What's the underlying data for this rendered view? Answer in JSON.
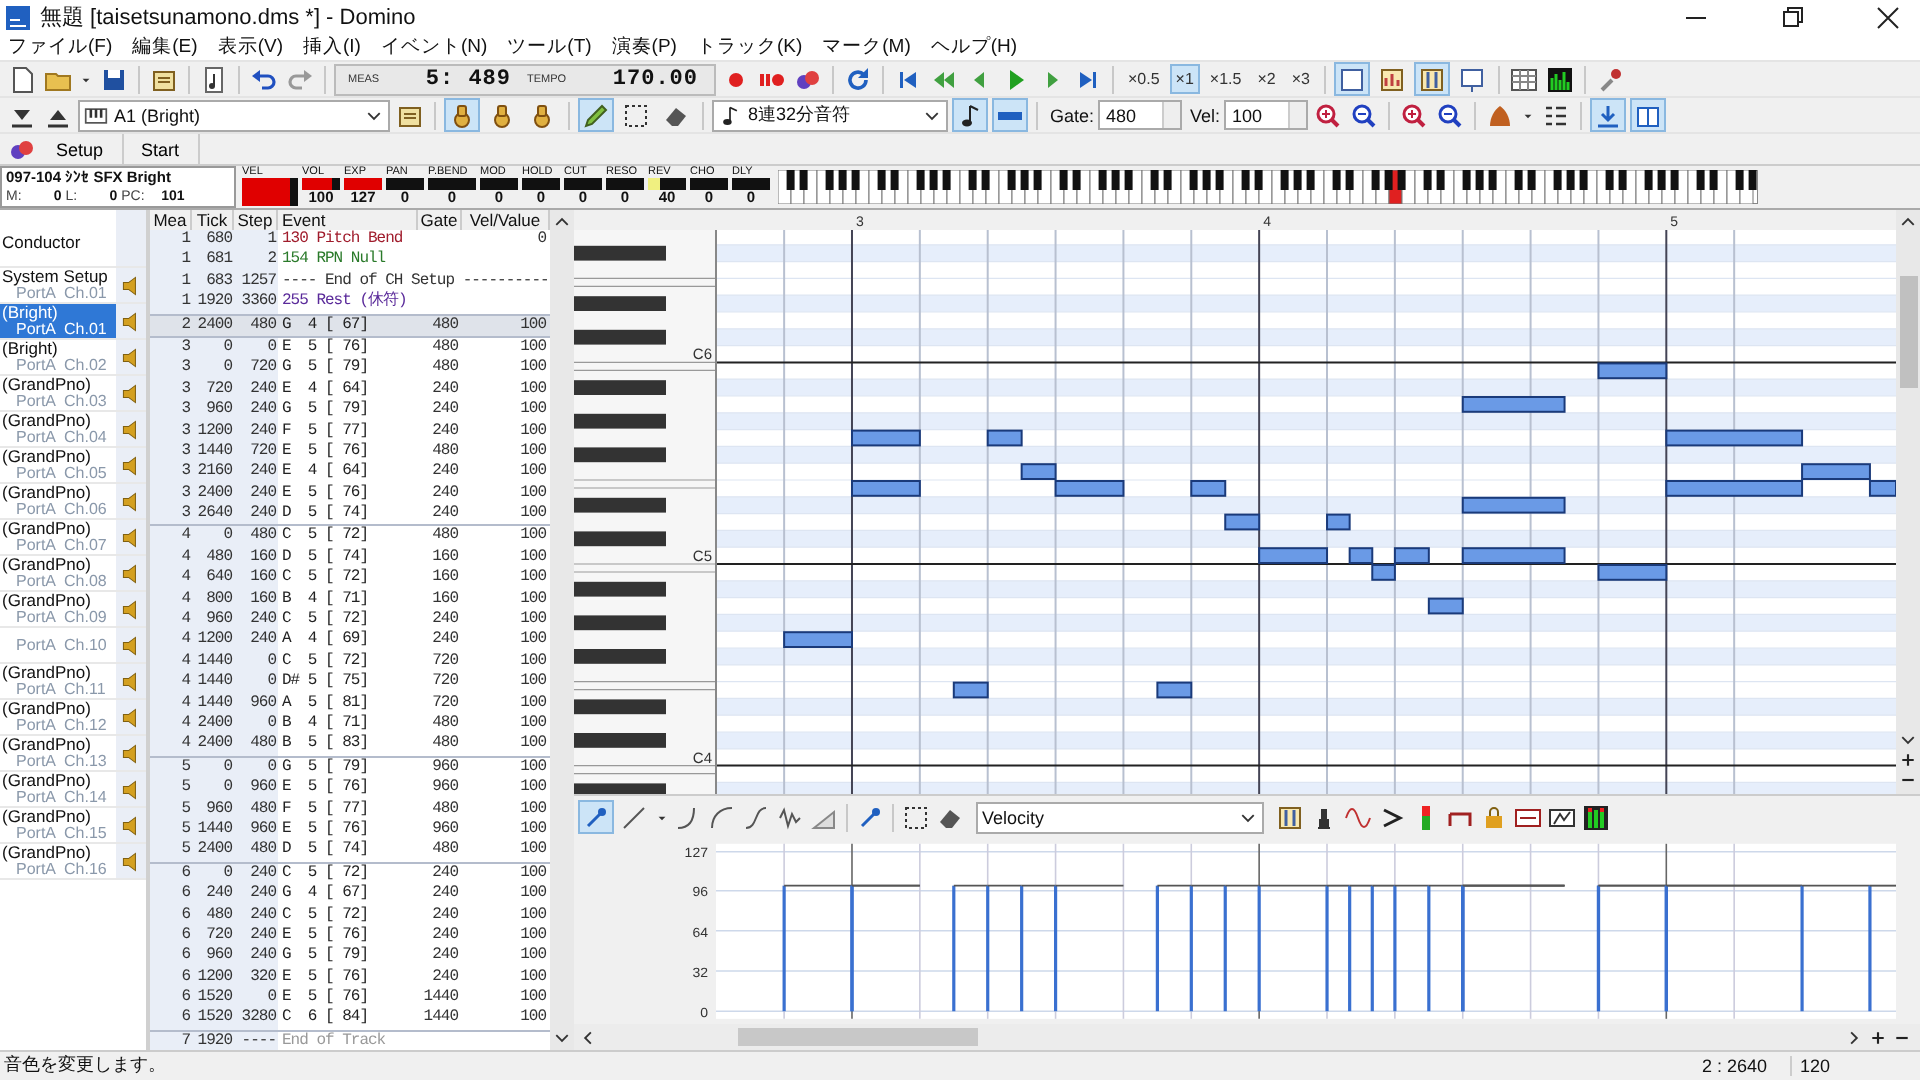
{
  "window": {
    "title": "無題 [taisetsunamono.dms *] - Domino"
  },
  "menu": [
    "ファイル(F)",
    "編集(E)",
    "表示(V)",
    "挿入(I)",
    "イベント(N)",
    "ツール(T)",
    "演奏(P)",
    "トラック(K)",
    "マーク(M)",
    "ヘルプ(H)"
  ],
  "transport": {
    "meas_label": "MEAS",
    "position": "5: 489",
    "tempo_label": "TEMPO",
    "tempo": "170.00"
  },
  "zoom_buttons": [
    {
      "label": "×0.5",
      "selected": false
    },
    {
      "label": "×1",
      "selected": true
    },
    {
      "label": "×1.5",
      "selected": false
    },
    {
      "label": "×2",
      "selected": false
    },
    {
      "label": "×3",
      "selected": false
    }
  ],
  "view_toggles": [
    {
      "selected": true
    },
    {
      "selected": false
    },
    {
      "selected": true
    },
    {
      "selected": false
    }
  ],
  "track_select": {
    "value": "A1 (Bright)"
  },
  "edit_modes": [
    {
      "selected": true
    },
    {
      "selected": false
    },
    {
      "selected": false
    }
  ],
  "draw_tools": [
    {
      "selected": true
    },
    {
      "selected": false
    },
    {
      "selected": false
    }
  ],
  "note_length": {
    "value": "8連32分音符"
  },
  "input_toggles": [
    {
      "selected": true
    },
    {
      "selected": true
    }
  ],
  "gate": {
    "label": "Gate:",
    "value": "480"
  },
  "velocity": {
    "label": "Vel:",
    "value": "100"
  },
  "panel_toggles": [
    {
      "selected": true
    },
    {
      "selected": true
    }
  ],
  "view_buttons": [
    "Setup",
    "Start"
  ],
  "channel_strip": {
    "instrument": "097-104 ｼﾝｾ SFX Bright",
    "m_label": "M:",
    "m": "0",
    "l_label": "L:",
    "l": "0",
    "pc_label": "PC:",
    "pc": "101",
    "meters": [
      {
        "label": "VEL",
        "level": 0.85,
        "color": "#e00000"
      },
      {
        "label": "VOL",
        "value": "100",
        "level": 0.79,
        "color": "#e00000"
      },
      {
        "label": "EXP",
        "value": "127",
        "level": 1,
        "color": "#e00000"
      },
      {
        "label": "PAN",
        "value": "0"
      },
      {
        "label": "P.BEND",
        "value": "0"
      },
      {
        "label": "MOD",
        "value": "0"
      },
      {
        "label": "HOLD",
        "value": "0"
      },
      {
        "label": "CUT",
        "value": "0"
      },
      {
        "label": "RESO",
        "value": "0"
      },
      {
        "label": "REV",
        "value": "40",
        "level": 0.31,
        "color": "#f0f080"
      },
      {
        "label": "CHO",
        "value": "0"
      },
      {
        "label": "DLY",
        "value": "0"
      }
    ]
  },
  "track_list": [
    {
      "name": "Conductor",
      "selected": false
    },
    {
      "name": "System Setup",
      "port": "PortA  Ch.01",
      "selected": false
    },
    {
      "name": "(Bright)",
      "port": "PortA  Ch.01",
      "selected": true
    },
    {
      "name": "(Bright)",
      "port": "PortA  Ch.02",
      "selected": false
    },
    {
      "name": "(GrandPno)",
      "port": "PortA  Ch.03",
      "selected": false
    },
    {
      "name": "(GrandPno)",
      "port": "PortA  Ch.04",
      "selected": false
    },
    {
      "name": "(GrandPno)",
      "port": "PortA  Ch.05",
      "selected": false
    },
    {
      "name": "(GrandPno)",
      "port": "PortA  Ch.06",
      "selected": false
    },
    {
      "name": "(GrandPno)",
      "port": "PortA  Ch.07",
      "selected": false
    },
    {
      "name": "(GrandPno)",
      "port": "PortA  Ch.08",
      "selected": false
    },
    {
      "name": "(GrandPno)",
      "port": "PortA  Ch.09",
      "selected": false
    },
    {
      "port": "PortA  Ch.10",
      "selected": false
    },
    {
      "name": "(GrandPno)",
      "port": "PortA  Ch.11",
      "selected": false
    },
    {
      "name": "(GrandPno)",
      "port": "PortA  Ch.12",
      "selected": false
    },
    {
      "name": "(GrandPno)",
      "port": "PortA  Ch.13",
      "selected": false
    },
    {
      "name": "(GrandPno)",
      "port": "PortA  Ch.14",
      "selected": false
    },
    {
      "name": "(GrandPno)",
      "port": "PortA  Ch.15",
      "selected": false
    },
    {
      "name": "(GrandPno)",
      "port": "PortA  Ch.16",
      "selected": false
    }
  ],
  "event_list": {
    "columns": [
      "Mea",
      "Tick",
      "Step",
      "Event",
      "Gate",
      "Vel/Value"
    ],
    "rows": [
      {
        "mea": "1",
        "tick": "680",
        "step": "1",
        "event": "130 Pitch Bend",
        "value": "0",
        "kind": "pitch_bend",
        "selected": false
      },
      {
        "mea": "1",
        "tick": "681",
        "step": "2",
        "event": "154 RPN Null",
        "kind": "rpn",
        "selected": false
      },
      {
        "mea": "1",
        "tick": "683",
        "step": "1257",
        "event": "---- End of CH Setup ----------",
        "kind": "separator",
        "selected": false
      },
      {
        "mea": "1",
        "tick": "1920",
        "step": "3360",
        "event": "255 Rest (休符)",
        "kind": "rest",
        "selected": false
      },
      {
        "mea": "2",
        "tick": "2400",
        "step": "480",
        "event": "G  4 [ 67]",
        "gate": "480",
        "value": "100",
        "kind": "note",
        "selected": true
      },
      {
        "mea": "3",
        "tick": "0",
        "step": "0",
        "event": "E  5 [ 76]",
        "gate": "480",
        "value": "100",
        "kind": "note",
        "selected": false
      },
      {
        "mea": "3",
        "tick": "0",
        "step": "720",
        "event": "G  5 [ 79]",
        "gate": "480",
        "value": "100",
        "kind": "note",
        "selected": false
      },
      {
        "mea": "3",
        "tick": "720",
        "step": "240",
        "event": "E  4 [ 64]",
        "gate": "240",
        "value": "100",
        "kind": "note",
        "selected": false
      },
      {
        "mea": "3",
        "tick": "960",
        "step": "240",
        "event": "G  5 [ 79]",
        "gate": "240",
        "value": "100",
        "kind": "note",
        "selected": false
      },
      {
        "mea": "3",
        "tick": "1200",
        "step": "240",
        "event": "F  5 [ 77]",
        "gate": "240",
        "value": "100",
        "kind": "note",
        "selected": false
      },
      {
        "mea": "3",
        "tick": "1440",
        "step": "720",
        "event": "E  5 [ 76]",
        "gate": "480",
        "value": "100",
        "kind": "note",
        "selected": false
      },
      {
        "mea": "3",
        "tick": "2160",
        "step": "240",
        "event": "E  4 [ 64]",
        "gate": "240",
        "value": "100",
        "kind": "note",
        "selected": false
      },
      {
        "mea": "3",
        "tick": "2400",
        "step": "240",
        "event": "E  5 [ 76]",
        "gate": "240",
        "value": "100",
        "kind": "note",
        "selected": false
      },
      {
        "mea": "3",
        "tick": "2640",
        "step": "240",
        "event": "D  5 [ 74]",
        "gate": "240",
        "value": "100",
        "kind": "note",
        "selected": false
      },
      {
        "mea": "4",
        "tick": "0",
        "step": "480",
        "event": "C  5 [ 72]",
        "gate": "480",
        "value": "100",
        "kind": "note",
        "selected": false
      },
      {
        "mea": "4",
        "tick": "480",
        "step": "160",
        "event": "D  5 [ 74]",
        "gate": "160",
        "value": "100",
        "kind": "note",
        "selected": false
      },
      {
        "mea": "4",
        "tick": "640",
        "step": "160",
        "event": "C  5 [ 72]",
        "gate": "160",
        "value": "100",
        "kind": "note",
        "selected": false
      },
      {
        "mea": "4",
        "tick": "800",
        "step": "160",
        "event": "B  4 [ 71]",
        "gate": "160",
        "value": "100",
        "kind": "note",
        "selected": false
      },
      {
        "mea": "4",
        "tick": "960",
        "step": "240",
        "event": "C  5 [ 72]",
        "gate": "240",
        "value": "100",
        "kind": "note",
        "selected": false
      },
      {
        "mea": "4",
        "tick": "1200",
        "step": "240",
        "event": "A  4 [ 69]",
        "gate": "240",
        "value": "100",
        "kind": "note",
        "selected": false
      },
      {
        "mea": "4",
        "tick": "1440",
        "step": "0",
        "event": "C  5 [ 72]",
        "gate": "720",
        "value": "100",
        "kind": "note",
        "selected": false
      },
      {
        "mea": "4",
        "tick": "1440",
        "step": "0",
        "event": "D# 5 [ 75]",
        "gate": "720",
        "value": "100",
        "kind": "note",
        "selected": false
      },
      {
        "mea": "4",
        "tick": "1440",
        "step": "960",
        "event": "A  5 [ 81]",
        "gate": "720",
        "value": "100",
        "kind": "note",
        "selected": false
      },
      {
        "mea": "4",
        "tick": "2400",
        "step": "0",
        "event": "B  4 [ 71]",
        "gate": "480",
        "value": "100",
        "kind": "note",
        "selected": false
      },
      {
        "mea": "4",
        "tick": "2400",
        "step": "480",
        "event": "B  5 [ 83]",
        "gate": "480",
        "value": "100",
        "kind": "note",
        "selected": false
      },
      {
        "mea": "5",
        "tick": "0",
        "step": "0",
        "event": "G  5 [ 79]",
        "gate": "960",
        "value": "100",
        "kind": "note",
        "selected": false
      },
      {
        "mea": "5",
        "tick": "0",
        "step": "960",
        "event": "E  5 [ 76]",
        "gate": "960",
        "value": "100",
        "kind": "note",
        "selected": false
      },
      {
        "mea": "5",
        "tick": "960",
        "step": "480",
        "event": "F  5 [ 77]",
        "gate": "480",
        "value": "100",
        "kind": "note",
        "selected": false
      },
      {
        "mea": "5",
        "tick": "1440",
        "step": "960",
        "event": "E  5 [ 76]",
        "gate": "960",
        "value": "100",
        "kind": "note",
        "selected": false
      },
      {
        "mea": "5",
        "tick": "2400",
        "step": "480",
        "event": "D  5 [ 74]",
        "gate": "480",
        "value": "100",
        "kind": "note",
        "selected": false
      },
      {
        "mea": "6",
        "tick": "0",
        "step": "240",
        "event": "C  5 [ 72]",
        "gate": "240",
        "value": "100",
        "kind": "note",
        "selected": false
      },
      {
        "mea": "6",
        "tick": "240",
        "step": "240",
        "event": "G  4 [ 67]",
        "gate": "240",
        "value": "100",
        "kind": "note",
        "selected": false
      },
      {
        "mea": "6",
        "tick": "480",
        "step": "240",
        "event": "C  5 [ 72]",
        "gate": "240",
        "value": "100",
        "kind": "note",
        "selected": false
      },
      {
        "mea": "6",
        "tick": "720",
        "step": "240",
        "event": "E  5 [ 76]",
        "gate": "240",
        "value": "100",
        "kind": "note",
        "selected": false
      },
      {
        "mea": "6",
        "tick": "960",
        "step": "240",
        "event": "G  5 [ 79]",
        "gate": "240",
        "value": "100",
        "kind": "note",
        "selected": false
      },
      {
        "mea": "6",
        "tick": "1200",
        "step": "320",
        "event": "E  5 [ 76]",
        "gate": "240",
        "value": "100",
        "kind": "note",
        "selected": false
      },
      {
        "mea": "6",
        "tick": "1520",
        "step": "0",
        "event": "E  5 [ 76]",
        "gate": "1440",
        "value": "100",
        "kind": "note",
        "selected": false
      },
      {
        "mea": "6",
        "tick": "1520",
        "step": "3280",
        "event": "C  6 [ 84]",
        "gate": "1440",
        "value": "100",
        "kind": "note",
        "selected": false
      },
      {
        "mea": "7",
        "tick": "1920",
        "step": "----",
        "event": "End of Track",
        "kind": "end",
        "selected": false
      }
    ]
  },
  "piano_roll": {
    "measures": [
      "3",
      "4",
      "5"
    ],
    "octave_labels": [
      "C6",
      "C5",
      "C4"
    ]
  },
  "controller": {
    "parameter": "Velocity",
    "tools": [
      {
        "selected": true
      },
      {
        "selected": false
      }
    ],
    "axis_labels": [
      "127",
      "96",
      "64",
      "32",
      "0"
    ]
  },
  "status_bar": {
    "message": "音色を変更します。",
    "position": "2 : 2640",
    "value": "120"
  }
}
